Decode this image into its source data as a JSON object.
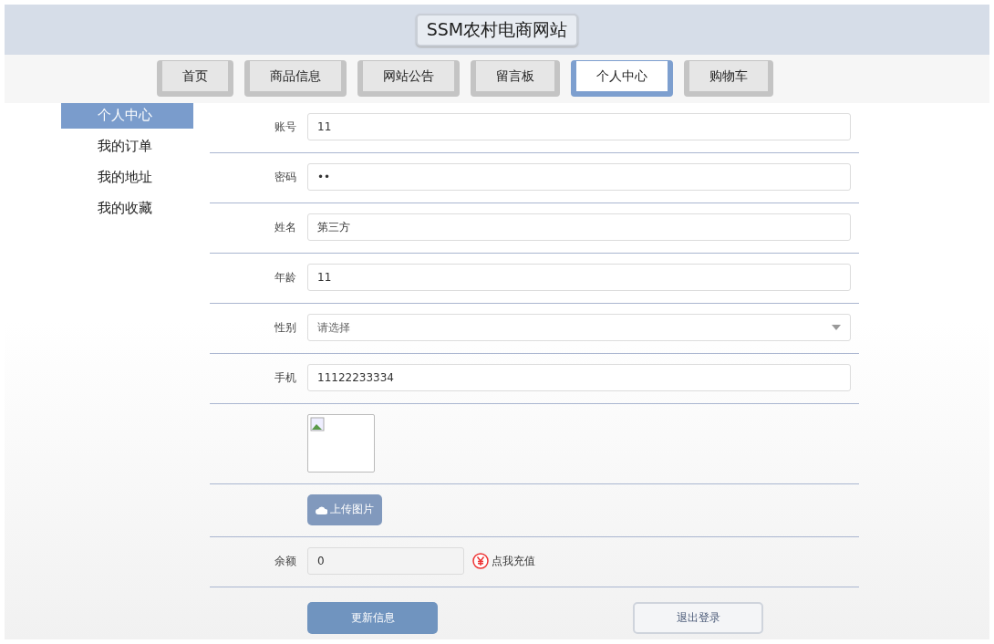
{
  "site_title": "SSM农村电商网站",
  "nav_tabs": [
    {
      "label": "首页",
      "selected": false
    },
    {
      "label": "商品信息",
      "selected": false
    },
    {
      "label": "网站公告",
      "selected": false
    },
    {
      "label": "留言板",
      "selected": false
    },
    {
      "label": "个人中心",
      "selected": true
    },
    {
      "label": "购物车",
      "selected": false
    }
  ],
  "sidebar": {
    "items": [
      {
        "label": "个人中心",
        "selected": true
      },
      {
        "label": "我的订单",
        "selected": false
      },
      {
        "label": "我的地址",
        "selected": false
      },
      {
        "label": "我的收藏",
        "selected": false
      }
    ]
  },
  "form": {
    "rows": [
      {
        "kind": "input",
        "label": "账号",
        "value": "11"
      },
      {
        "kind": "input",
        "label": "密码",
        "value": "••"
      },
      {
        "kind": "input",
        "label": "姓名",
        "value": "第三方"
      },
      {
        "kind": "input",
        "label": "年龄",
        "value": "11"
      },
      {
        "kind": "select",
        "label": "性别",
        "placeholder": "请选择"
      },
      {
        "kind": "input",
        "label": "手机",
        "value": "11122233334"
      },
      {
        "kind": "image"
      },
      {
        "kind": "upload",
        "button": "上传图片",
        "disabled": true
      },
      {
        "kind": "balance",
        "label": "余额",
        "value": "0",
        "link": "点我充值"
      }
    ],
    "buttons": [
      {
        "label": "更新信息",
        "kind": "primary"
      },
      {
        "label": "退出登录",
        "kind": "secondary"
      }
    ]
  }
}
